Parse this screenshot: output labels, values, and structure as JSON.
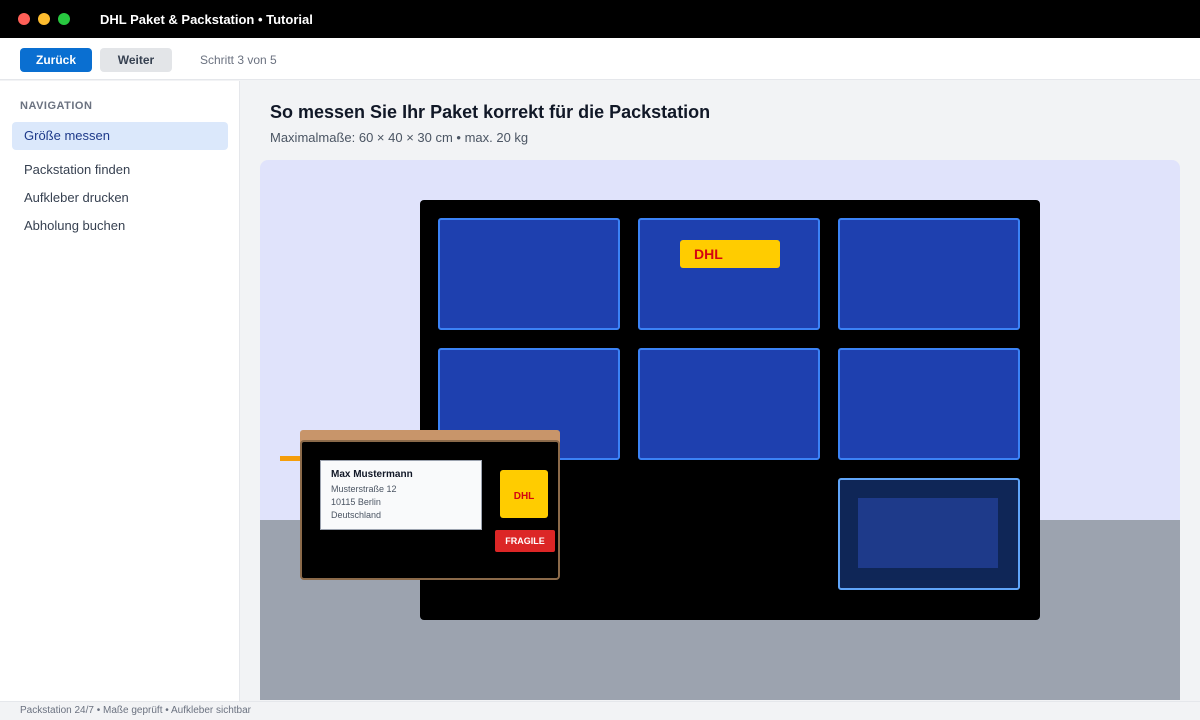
{
  "window": {
    "title": "DHL Paket & Packstation • Tutorial"
  },
  "toolbar": {
    "back_label": "Zurück",
    "next_label": "Weiter",
    "step_text": "Schritt 3 von 5"
  },
  "sidebar": {
    "heading": "NAVIGATION",
    "items": [
      {
        "label": "Größe messen",
        "active": true
      },
      {
        "label": "Packstation finden",
        "active": false
      },
      {
        "label": "Aufkleber drucken",
        "active": false
      },
      {
        "label": "Abholung buchen",
        "active": false
      }
    ]
  },
  "main": {
    "title": "So messen Sie Ihr Paket korrekt für die Packstation",
    "subtitle": "Maximalmaße: 60 × 40 × 30 cm • max. 20 kg"
  },
  "scene": {
    "station_sign": "DHL",
    "package": {
      "name": "Max Mustermann",
      "street": "Musterstraße 12",
      "city": "10115 Berlin",
      "country": "Deutschland",
      "logo": "DHL",
      "fragile_label": "FRAGILE"
    },
    "colors": {
      "dhl_yellow": "#ffcc00",
      "dhl_red": "#d40511",
      "locker_blue": "#1e40af",
      "accent_blue": "#0a6fd1"
    }
  },
  "status": {
    "text": "Packstation 24/7 • Maße geprüft • Aufkleber sichtbar"
  }
}
